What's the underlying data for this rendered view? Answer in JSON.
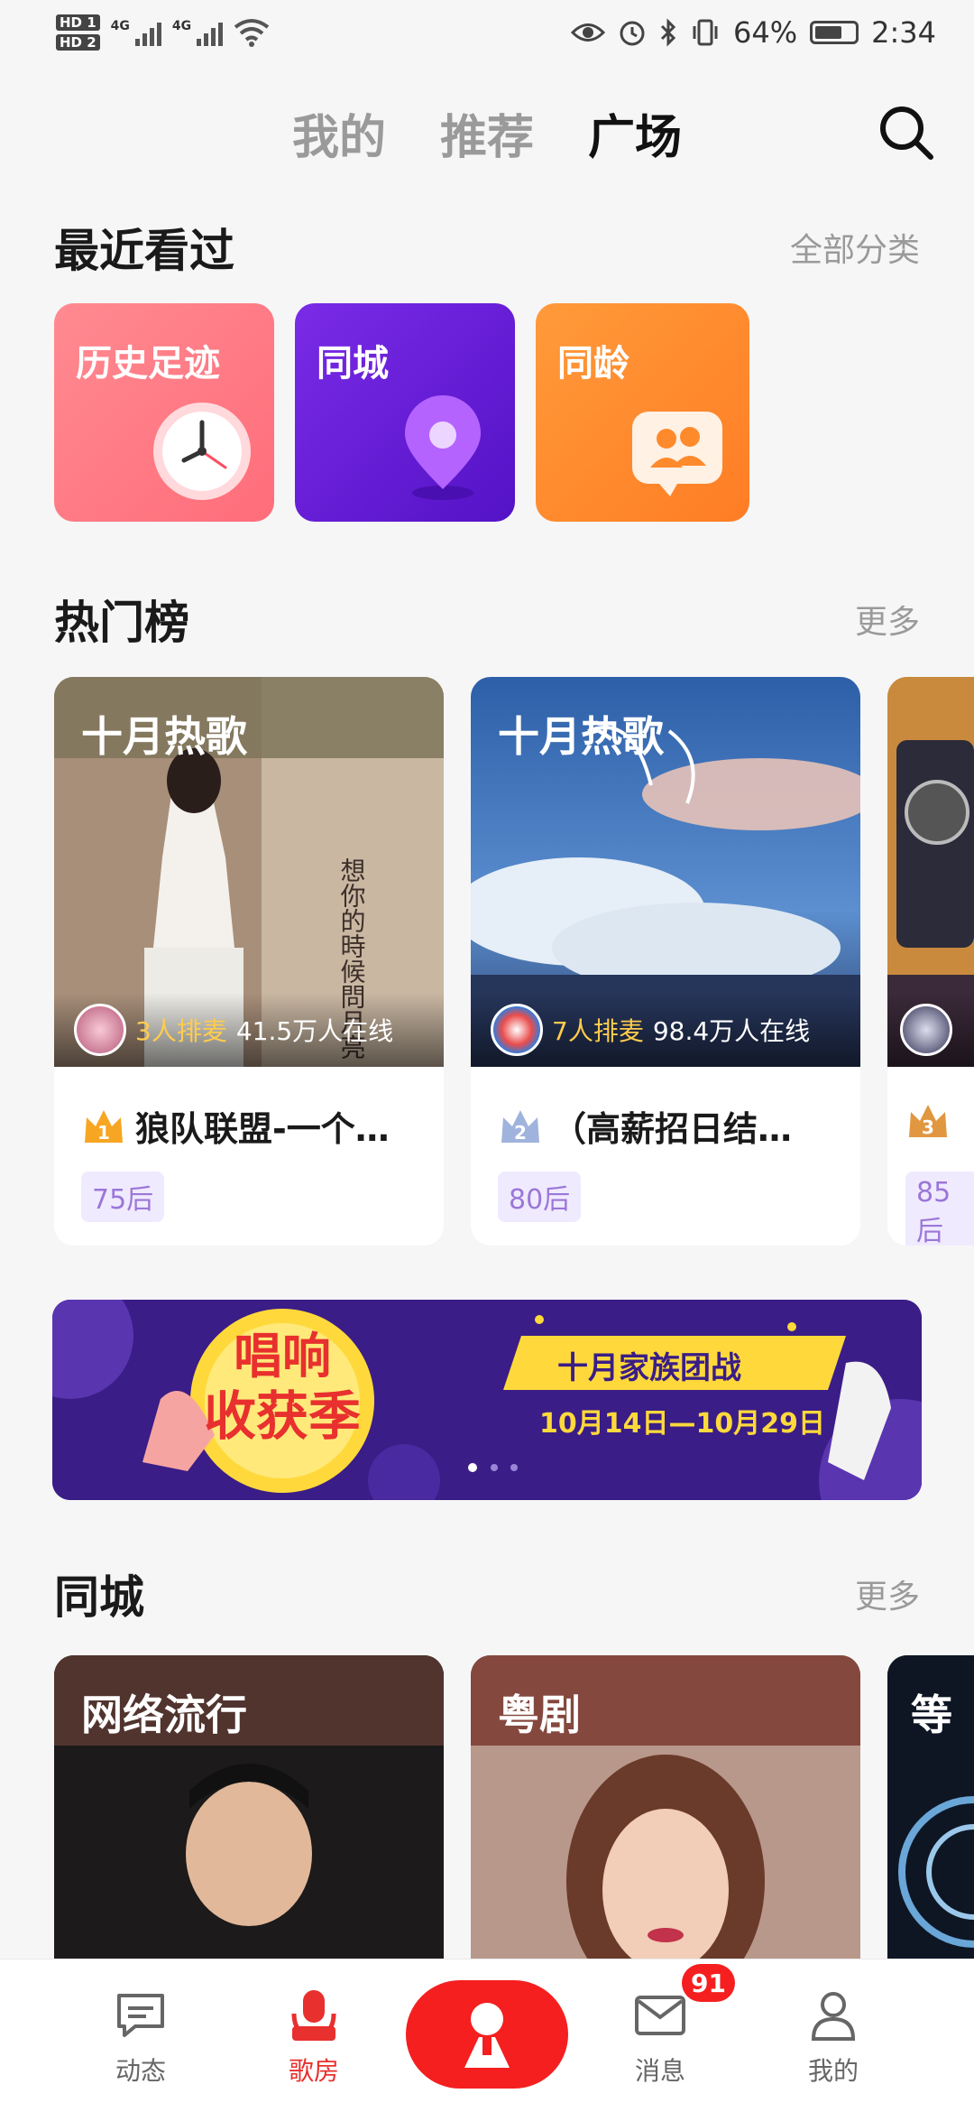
{
  "status_bar": {
    "hd1": "HD 1",
    "hd2": "HD 2",
    "net1": "4G",
    "net2": "4G",
    "battery": "64%",
    "time": "2:34"
  },
  "top_tabs": [
    {
      "label": "我的"
    },
    {
      "label": "推荐"
    },
    {
      "label": "广场",
      "active": true
    }
  ],
  "recent": {
    "title": "最近看过",
    "more": "全部分类",
    "tiles": [
      {
        "label": "历史足迹",
        "color": "#ff7b86",
        "icon": "clock-icon"
      },
      {
        "label": "同城",
        "color": "#6a1ed8",
        "icon": "location-pin-icon"
      },
      {
        "label": "同龄",
        "color": "#ff8a2c",
        "icon": "group-icon"
      }
    ]
  },
  "hot": {
    "title": "热门榜",
    "more": "更多",
    "cards": [
      {
        "cover_title": "十月热歌",
        "queue": "3人排麦",
        "online": "41.5万人在线",
        "rank": "1",
        "name": "狼队联盟-一个…",
        "age": "75后"
      },
      {
        "cover_title": "十月热歌",
        "queue": "7人排麦",
        "online": "98.4万人在线",
        "rank": "2",
        "name": "（高薪招日结…",
        "age": "80后"
      },
      {
        "cover_title": "",
        "queue": "",
        "online": "",
        "rank": "3",
        "name": "",
        "age": "85后"
      }
    ]
  },
  "banner": {
    "title_line1": "唱响",
    "title_line2": "收获季",
    "event": "十月家族团战",
    "dates": "10月14日—10月29日"
  },
  "city": {
    "title": "同城",
    "more": "更多",
    "cards": [
      {
        "label": "网络流行"
      },
      {
        "label": "粤剧"
      },
      {
        "label": "等"
      }
    ]
  },
  "bottom_nav": {
    "items": [
      {
        "label": "动态",
        "icon": "chat-icon"
      },
      {
        "label": "歌房",
        "icon": "microphone-icon",
        "active": true
      },
      {
        "label": "消息",
        "icon": "mail-icon"
      },
      {
        "label": "我的",
        "icon": "person-icon"
      }
    ],
    "badge": "91"
  },
  "colors": {
    "accent": "#f51f1f",
    "age_tag_bg": "#f0eaff",
    "age_tag_text": "#9b77d8"
  }
}
